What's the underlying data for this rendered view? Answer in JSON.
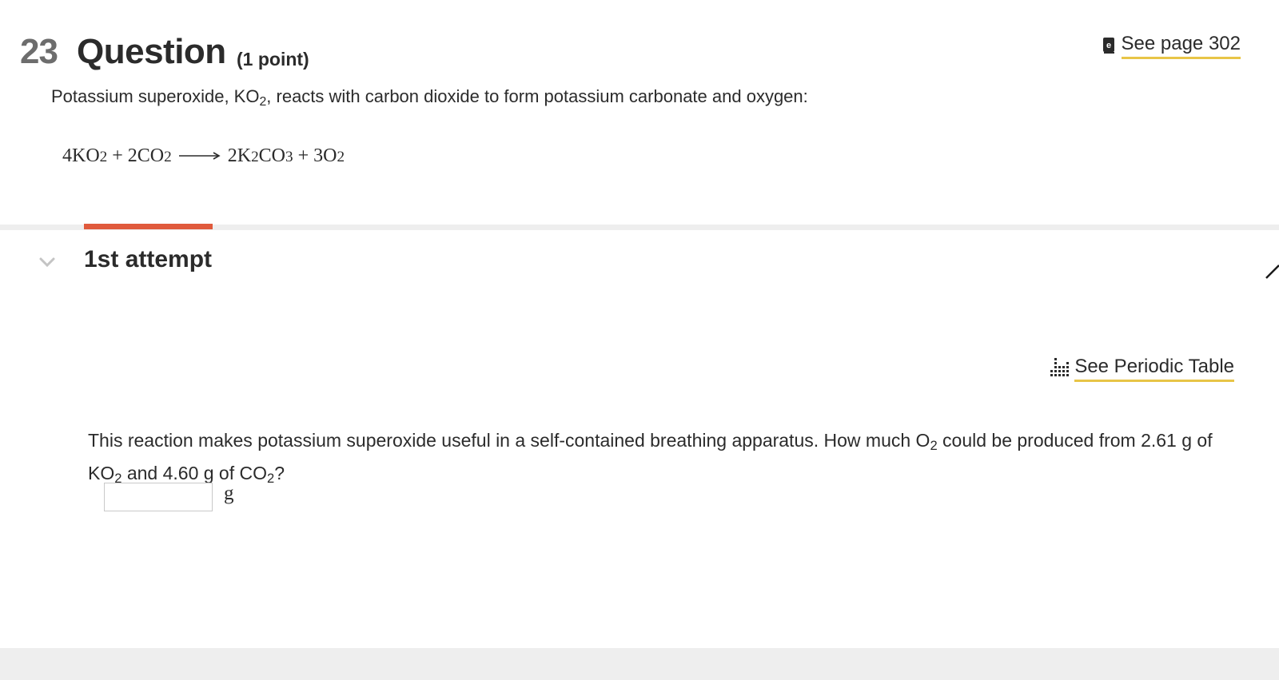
{
  "header": {
    "number": "23",
    "title": "Question",
    "points": "(1 point)",
    "see_page": "See page 302"
  },
  "intro": {
    "prefix": "Potassium superoxide, KO",
    "sub": "2",
    "suffix": ", reacts with carbon dioxide to form potassium carbonate and oxygen:"
  },
  "equation": {
    "r1": "4KO",
    "r1_sub": "2",
    "plus1": " + 2CO",
    "r2_sub": "2",
    "p1": "2K",
    "p1_sub": "2",
    "p2": "CO",
    "p2_sub": "3",
    "plus2": " + 3O",
    "p3_sub": "2"
  },
  "attempt": {
    "label": "1st attempt"
  },
  "periodic_table": {
    "label": "See Periodic Table"
  },
  "question": {
    "t1": "This reaction makes potassium superoxide useful in a self-contained breathing apparatus. How much O",
    "s1": "2",
    "t2": " could be produced from 2.61 g of KO",
    "s2": "2",
    "t3": " and 4.60 g of CO",
    "s3": "2",
    "t4": "?"
  },
  "answer": {
    "value": "",
    "unit": "g"
  },
  "colors": {
    "accent_underline": "#e8c547",
    "attempt_bar": "#e05a3c"
  }
}
